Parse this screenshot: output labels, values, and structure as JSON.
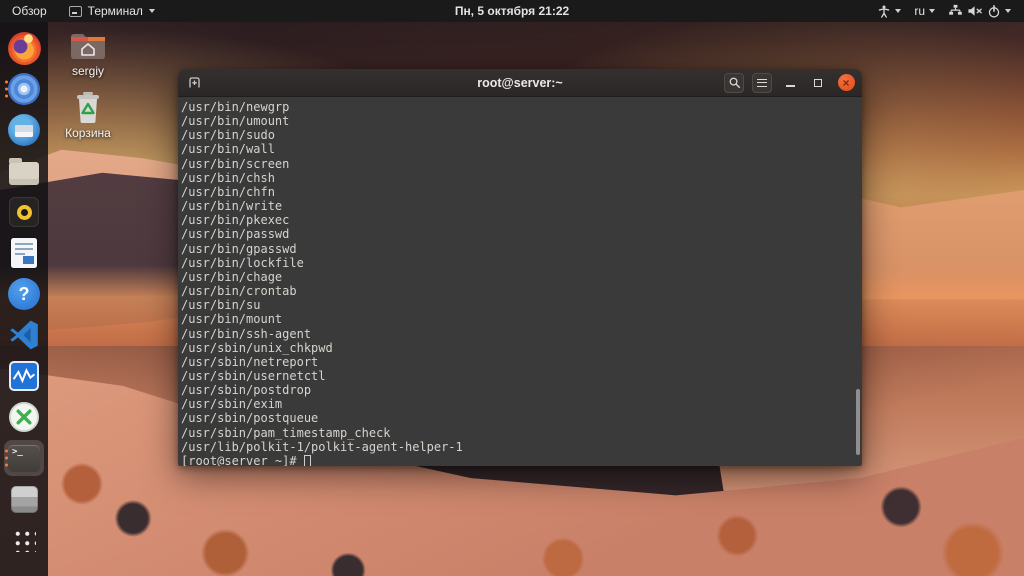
{
  "topbar": {
    "activities_label": "Обзор",
    "app_menu_label": "Терминал",
    "clock": "Пн, 5 октября 21:22",
    "keyboard_layout": "ru",
    "indicator_icons": [
      "accessibility-icon",
      "keyboard-layout-indicator",
      "network-wired-icon",
      "volume-muted-icon",
      "power-icon"
    ]
  },
  "desktop_icons": [
    {
      "label": "sergiy",
      "icon": "home-folder-icon"
    },
    {
      "label": "Корзина",
      "icon": "trash-icon"
    }
  ],
  "dock": {
    "items": [
      {
        "name": "firefox-icon"
      },
      {
        "name": "chromium-icon",
        "running_windows": 3
      },
      {
        "name": "thunderbird-icon"
      },
      {
        "name": "files-icon"
      },
      {
        "name": "rhythmbox-icon"
      },
      {
        "name": "libreoffice-writer-icon"
      },
      {
        "name": "help-icon"
      },
      {
        "name": "vscode-icon"
      },
      {
        "name": "system-monitor-icon"
      },
      {
        "name": "x-server-icon"
      },
      {
        "name": "terminal-icon",
        "running_windows": 3,
        "active": true
      },
      {
        "name": "package-icon"
      },
      {
        "name": "app-grid-icon"
      }
    ]
  },
  "terminal_window": {
    "title": "root@server:~",
    "titlebar_icons": [
      "new-tab-icon",
      "search-icon",
      "menu-icon",
      "minimize-icon",
      "maximize-icon",
      "close-icon"
    ],
    "help_icon_glyph": "?",
    "terminal_glyph": ">_",
    "output_lines": [
      "/usr/bin/newgrp",
      "/usr/bin/umount",
      "/usr/bin/sudo",
      "/usr/bin/wall",
      "/usr/bin/screen",
      "/usr/bin/chsh",
      "/usr/bin/chfn",
      "/usr/bin/write",
      "/usr/bin/pkexec",
      "/usr/bin/passwd",
      "/usr/bin/gpasswd",
      "/usr/bin/lockfile",
      "/usr/bin/chage",
      "/usr/bin/crontab",
      "/usr/bin/su",
      "/usr/bin/mount",
      "/usr/bin/ssh-agent",
      "/usr/sbin/unix_chkpwd",
      "/usr/sbin/netreport",
      "/usr/sbin/usernetctl",
      "/usr/sbin/postdrop",
      "/usr/sbin/exim",
      "/usr/sbin/postqueue",
      "/usr/sbin/pam_timestamp_check",
      "/usr/lib/polkit-1/polkit-agent-helper-1"
    ],
    "prompt": "[root@server ~]#",
    "cursor": "hollow-block",
    "close_glyph": "×"
  },
  "colors": {
    "ubuntu_orange": "#e95420",
    "running_dot": "#ff7a33",
    "topbar_bg": "#1a1a1a",
    "titlebar_bg": "#2d2926",
    "terminal_bg": "#3a3a3a",
    "terminal_text": "#d7d3cd"
  }
}
